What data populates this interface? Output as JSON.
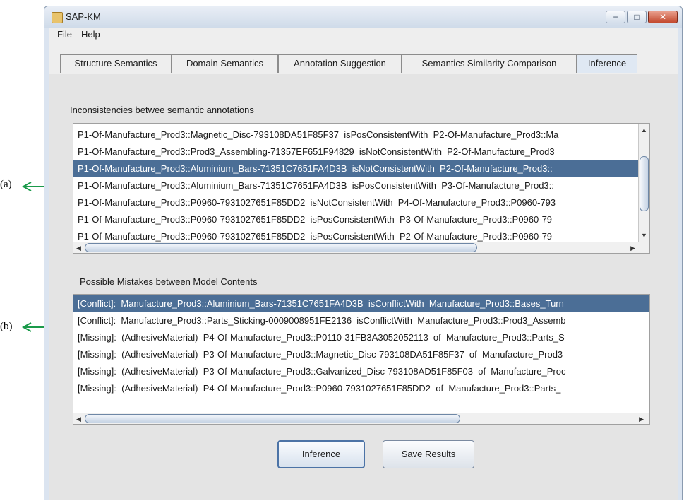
{
  "window": {
    "title": "SAP-KM",
    "buttons": {
      "minimize": "−",
      "maximize": "□",
      "close": "✕"
    }
  },
  "menu": [
    "File",
    "Help"
  ],
  "tabs": [
    "Structure Semantics",
    "Domain Semantics",
    "Annotation Suggestion",
    "Semantics Similarity Comparison",
    "Inference"
  ],
  "annotations": {
    "a": "(a)",
    "b": "(b)",
    "arrow_color": "#1a9a4a"
  },
  "inconsistencies": {
    "title": "Inconsistencies betwee semantic annotations",
    "rows": [
      "P1-Of-Manufacture_Prod3::Magnetic_Disc-793108DA51F85F37  isPosConsistentWith  P2-Of-Manufacture_Prod3::Ma",
      "P1-Of-Manufacture_Prod3::Prod3_Assembling-71357EF651F94829  isNotConsistentWith  P2-Of-Manufacture_Prod3",
      "P1-Of-Manufacture_Prod3::Aluminium_Bars-71351C7651FA4D3B  isNotConsistentWith  P2-Of-Manufacture_Prod3::",
      "P1-Of-Manufacture_Prod3::Aluminium_Bars-71351C7651FA4D3B  isPosConsistentWith  P3-Of-Manufacture_Prod3::",
      "P1-Of-Manufacture_Prod3::P0960-7931027651F85DD2  isNotConsistentWith  P4-Of-Manufacture_Prod3::P0960-793",
      "P1-Of-Manufacture_Prod3::P0960-7931027651F85DD2  isPosConsistentWith  P3-Of-Manufacture_Prod3::P0960-79",
      "P1-Of-Manufacture_Prod3::P0960-7931027651F85DD2  isPosConsistentWith  P2-Of-Manufacture_Prod3::P0960-79"
    ],
    "selected_index": 2
  },
  "mistakes": {
    "title": "Possible Mistakes between Model Contents",
    "rows": [
      "[Conflict]:  Manufacture_Prod3::Aluminium_Bars-71351C7651FA4D3B  isConflictWith  Manufacture_Prod3::Bases_Turn",
      "[Conflict]:  Manufacture_Prod3::Parts_Sticking-0009008951FE2136  isConflictWith  Manufacture_Prod3::Prod3_Assemb",
      "[Missing]:  (AdhesiveMaterial)  P4-Of-Manufacture_Prod3::P0110-31FB3A3052052113  of  Manufacture_Prod3::Parts_S",
      "[Missing]:  (AdhesiveMaterial)  P3-Of-Manufacture_Prod3::Magnetic_Disc-793108DA51F85F37  of  Manufacture_Prod3",
      "[Missing]:  (AdhesiveMaterial)  P3-Of-Manufacture_Prod3::Galvanized_Disc-793108AD51F85F03  of  Manufacture_Proc",
      "[Missing]:  (AdhesiveMaterial)  P4-Of-Manufacture_Prod3::P0960-7931027651F85DD2  of  Manufacture_Prod3::Parts_"
    ],
    "selected_index": 0
  },
  "actions": {
    "inference": "Inference",
    "save": "Save Results"
  },
  "colors": {
    "selection": "#4b6e96",
    "panel": "#e4e4e4"
  }
}
